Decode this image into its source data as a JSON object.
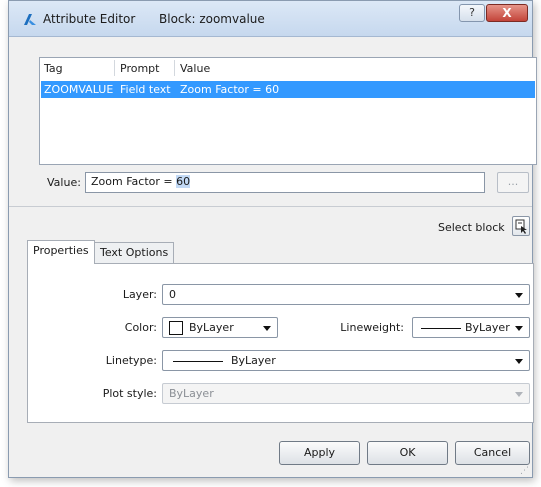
{
  "window": {
    "title": "Attribute Editor",
    "subtitle": "Block: zoomvalue",
    "help_glyph": "?",
    "close_glyph": "X",
    "icons": {
      "app": "autocad-logo-icon",
      "help": "help-icon",
      "close": "close-icon"
    },
    "colors": {
      "close": "#c3443a",
      "selection": "#3399ff"
    }
  },
  "attributes": {
    "columns": [
      "Tag",
      "Prompt",
      "Value"
    ],
    "rows": [
      {
        "tag": "ZOOMVALUE",
        "prompt": "Field text",
        "value": "Zoom Factor = 60",
        "selected": true
      }
    ]
  },
  "value_field": {
    "label": "Value:",
    "text_prefix": "Zoom Factor = ",
    "text_selected": "60",
    "browse_label": "..."
  },
  "select_block": {
    "label": "Select block",
    "icon": "select-block-icon"
  },
  "tabs": [
    {
      "label": "Properties",
      "active": true
    },
    {
      "label": "Text Options",
      "active": false
    }
  ],
  "properties": {
    "layer": {
      "label": "Layer:",
      "value": "0"
    },
    "color": {
      "label": "Color:",
      "value": "ByLayer"
    },
    "lineweight": {
      "label": "Lineweight:",
      "value": "ByLayer"
    },
    "linetype": {
      "label": "Linetype:",
      "value": "ByLayer"
    },
    "plot_style": {
      "label": "Plot style:",
      "value": "ByLayer",
      "disabled": true
    }
  },
  "buttons": {
    "apply": "Apply",
    "ok": "OK",
    "cancel": "Cancel"
  }
}
